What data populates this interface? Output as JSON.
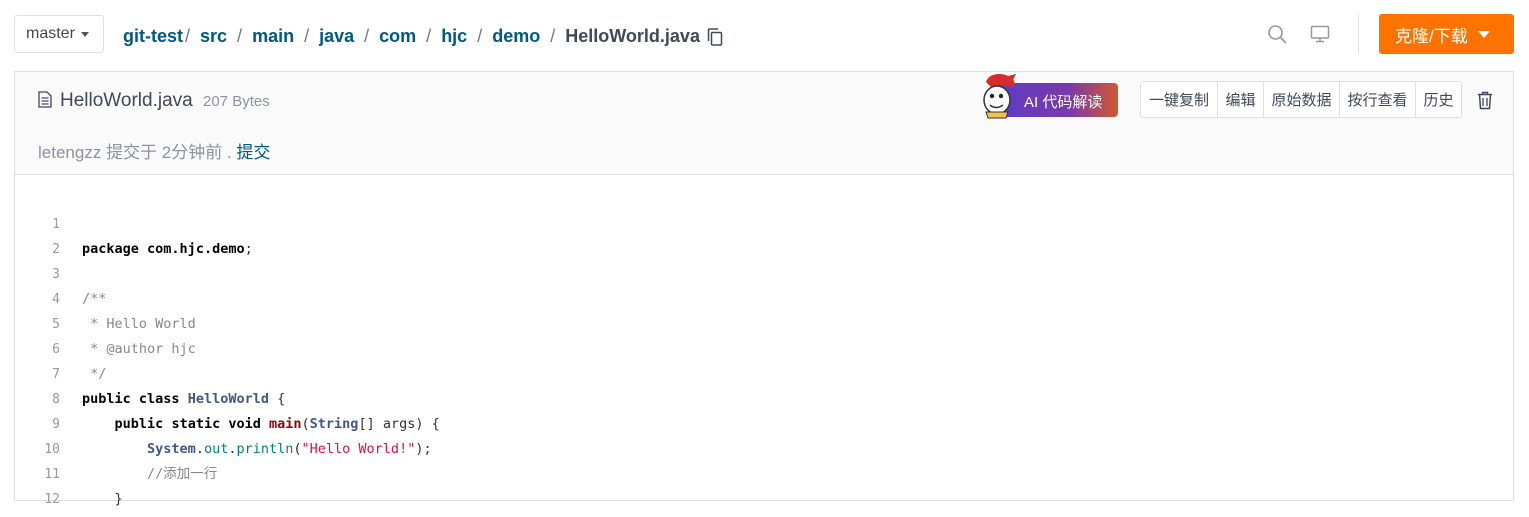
{
  "topbar": {
    "branch": "master",
    "breadcrumbs": [
      "git-test",
      "src",
      "main",
      "java",
      "com",
      "hjc",
      "demo"
    ],
    "current_file": "HelloWorld.java",
    "clone_label": "克隆/下载"
  },
  "file": {
    "name": "HelloWorld.java",
    "size": "207 Bytes",
    "commit_author": "letengzz",
    "commit_text": "提交于",
    "commit_time": "2分钟前",
    "commit_sep": ".",
    "commit_link": "提交"
  },
  "toolbar": {
    "ai_label": "AI 代码解读",
    "buttons": [
      "一键复制",
      "编辑",
      "原始数据",
      "按行查看",
      "历史"
    ]
  },
  "code": {
    "language": "java",
    "lines": [
      "package com.hjc.demo;",
      "",
      "/**",
      " * Hello World",
      " * @author hjc",
      " */",
      "public class HelloWorld {",
      "    public static void main(String[] args) {",
      "        System.out.println(\"Hello World!\");",
      "        //添加一行",
      "    }",
      "}"
    ]
  },
  "colors": {
    "clone_button": "#fe7300",
    "link": "#005980"
  }
}
